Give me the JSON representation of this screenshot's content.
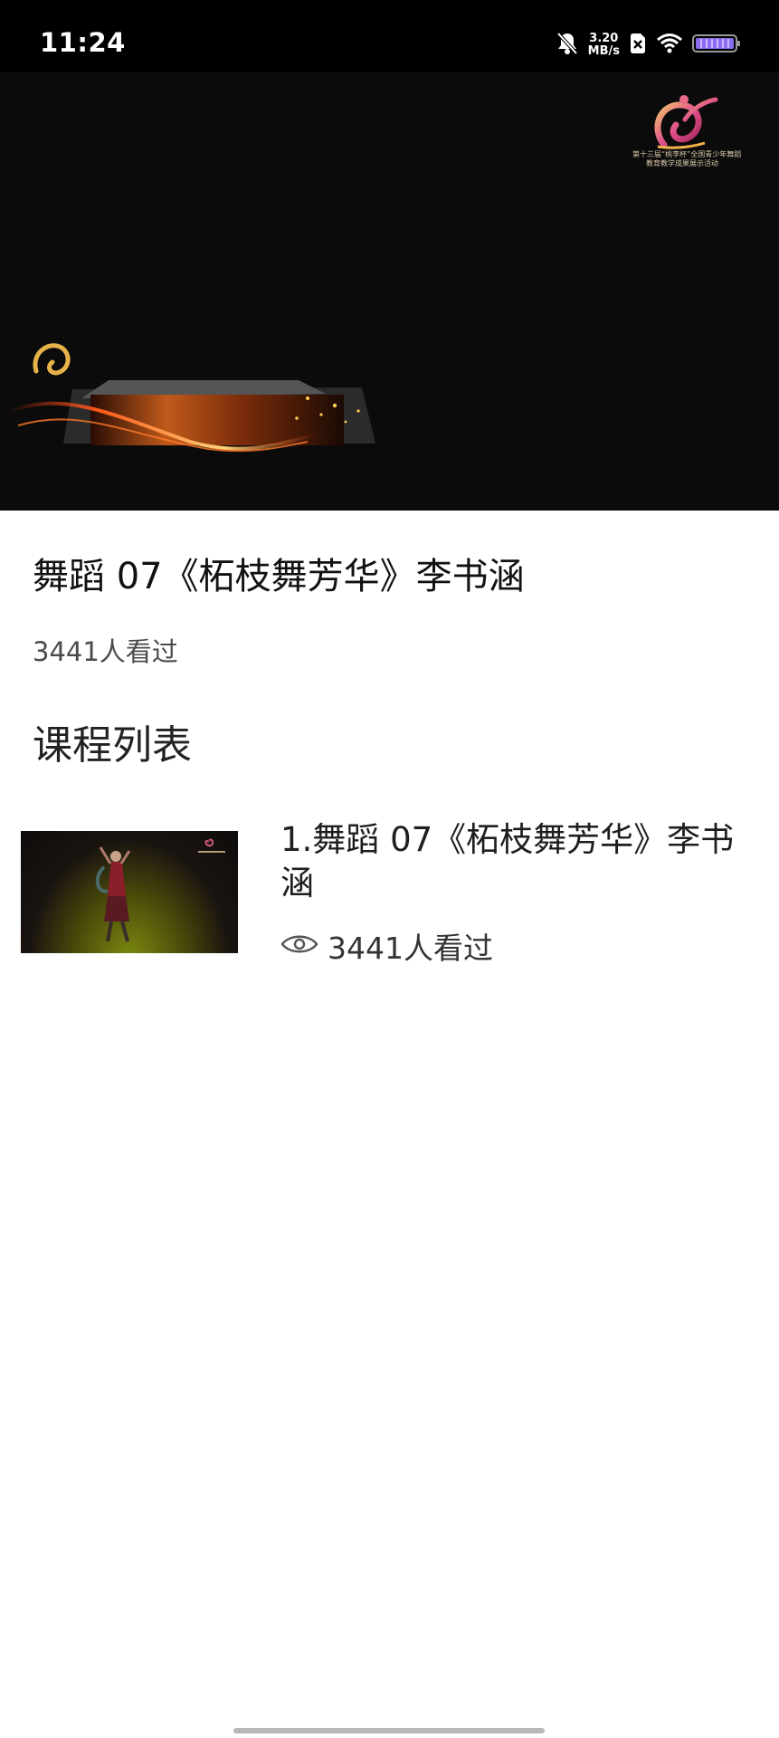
{
  "status_bar": {
    "time": "11:24",
    "net_speed_value": "3.20",
    "net_speed_unit": "MB/s"
  },
  "video": {
    "watermark_text_line1": "第十三届“桃李杯”全国青少年舞蹈",
    "watermark_text_line2": "教育教学成果展示活动"
  },
  "info": {
    "title": "舞蹈  07《柘枝舞芳华》李书涵",
    "views": "3441人看过"
  },
  "section": {
    "title": "课程列表"
  },
  "course_list": [
    {
      "title": "1.舞蹈  07《柘枝舞芳华》李书涵",
      "views": "3441人看过"
    }
  ],
  "colors": {
    "status_bar_bg": "#000000",
    "player_bg": "#0b0b0b",
    "page_bg": "#ffffff"
  }
}
